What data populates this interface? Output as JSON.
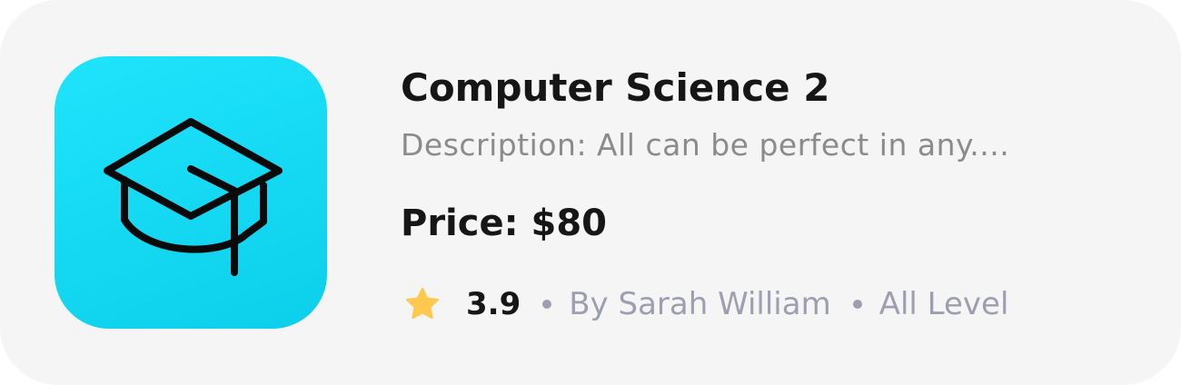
{
  "course": {
    "title": "Computer Science 2",
    "description": "Description: All can be perfect in any....",
    "price": "Price: $80",
    "rating": "3.9",
    "author": "By Sarah William",
    "level": "All Level"
  },
  "icons": {
    "thumbnail": "graduation-cap-icon",
    "rating": "star-icon",
    "separator": "dot"
  },
  "colors": {
    "card_background": "#f5f5f5",
    "thumbnail_gradient_start": "#1fe4fb",
    "thumbnail_gradient_end": "#0ccfeb",
    "title": "#161616",
    "description": "#8b8b8b",
    "meta": "#9d9fb0",
    "star": "#ffc94f"
  }
}
